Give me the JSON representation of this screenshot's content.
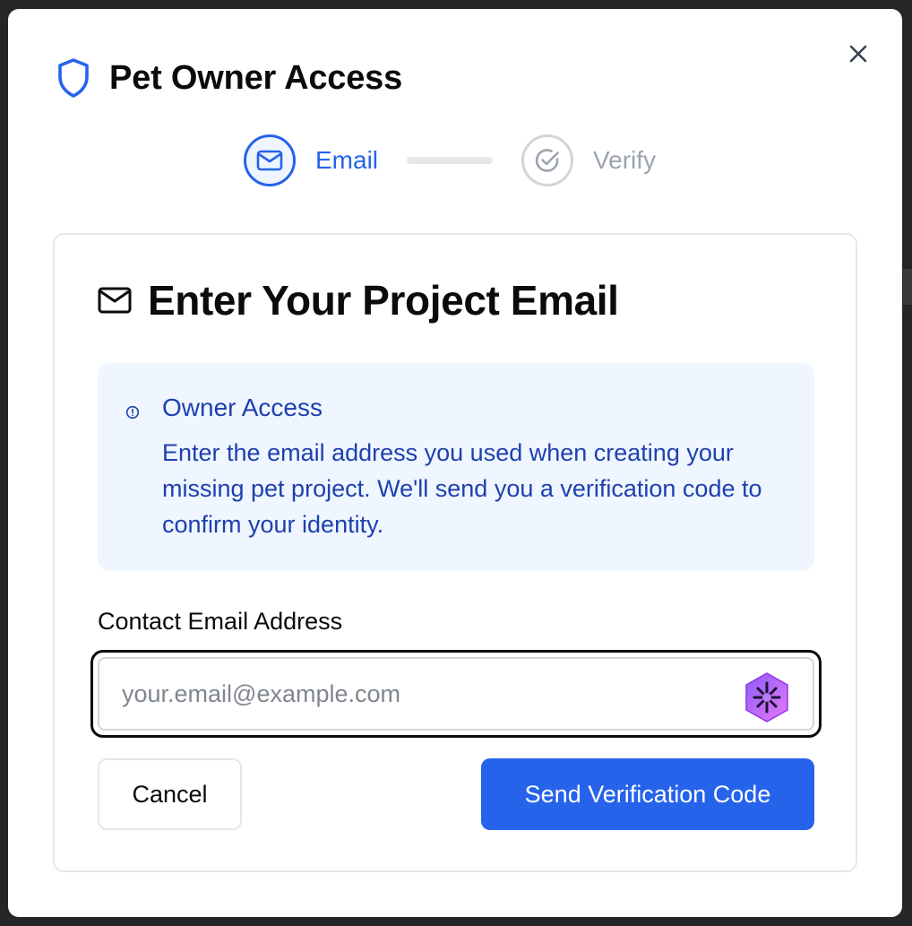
{
  "header": {
    "title": "Pet Owner Access",
    "icon": "shield-icon"
  },
  "stepper": {
    "steps": [
      {
        "label": "Email",
        "icon": "mail-icon",
        "state": "active"
      },
      {
        "label": "Verify",
        "icon": "check-circle-icon",
        "state": "inactive"
      }
    ]
  },
  "card": {
    "title": "Enter Your Project Email",
    "icon": "mail-icon",
    "info": {
      "icon": "info-icon",
      "title": "Owner Access",
      "body": "Enter the email address you used when creating your missing pet project. We'll send you a verification code to confirm your identity."
    },
    "form": {
      "label": "Contact Email Address",
      "value": "",
      "placeholder": "your.email@example.com",
      "extension_icon": "password-manager-icon"
    },
    "actions": {
      "cancel_label": "Cancel",
      "submit_label": "Send Verification Code"
    }
  },
  "colors": {
    "primary": "#2563eb",
    "info_bg": "#eff6ff",
    "info_text": "#1e40af",
    "muted": "#9ca3af"
  }
}
